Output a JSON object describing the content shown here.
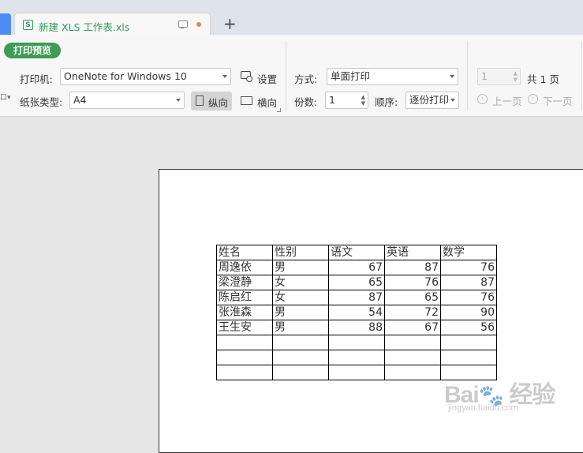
{
  "tab": {
    "title": "新建 XLS 工作表.xls",
    "new_tab": "+"
  },
  "toolbar": {
    "preview_button": "打印预览",
    "printer_label": "打印机:",
    "printer_value": "OneNote for Windows 10",
    "settings_label": "设置",
    "paper_label": "纸张类型:",
    "paper_value": "A4",
    "portrait_label": "纵向",
    "landscape_label": "横向",
    "mode_label": "方式:",
    "mode_value": "单面打印",
    "copies_label": "份数:",
    "copies_value": "1",
    "order_label": "顺序:",
    "order_value": "逐份打印",
    "page_value": "1",
    "total_pages": "共 1 页",
    "prev_page": "上一页",
    "next_page": "下一页"
  },
  "sheet": {
    "headers": [
      "姓名",
      "性别",
      "语文",
      "英语",
      "数学"
    ],
    "rows": [
      [
        "周逸依",
        "男",
        "67",
        "87",
        "76"
      ],
      [
        "梁澄静",
        "女",
        "65",
        "76",
        "87"
      ],
      [
        "陈启红",
        "女",
        "87",
        "65",
        "76"
      ],
      [
        "张淮森",
        "男",
        "54",
        "72",
        "90"
      ],
      [
        " 王生安",
        "男",
        "88",
        "67",
        "56"
      ]
    ],
    "empty_rows": 3
  },
  "watermark": {
    "logo": "Bai&度 经验",
    "url": "jingyan.baidu.com"
  }
}
